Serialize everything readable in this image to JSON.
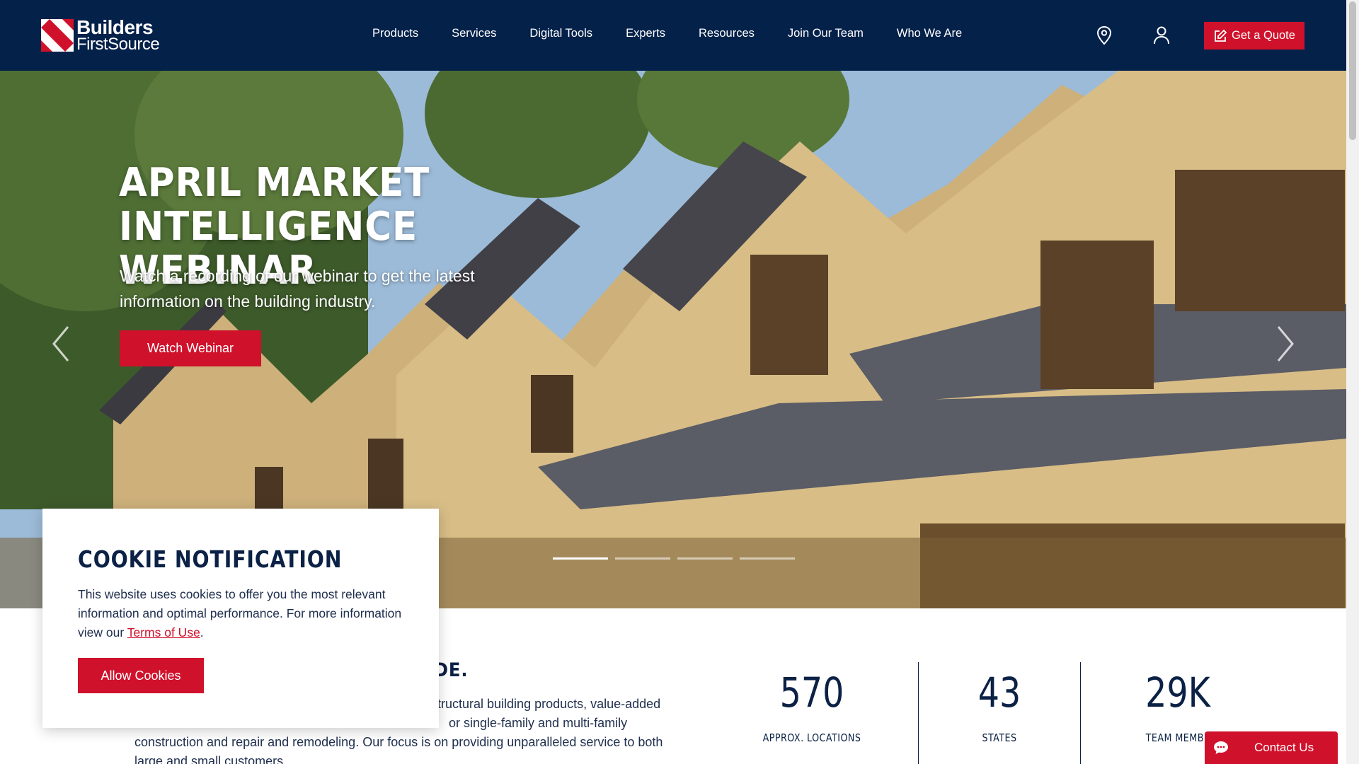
{
  "brand": {
    "logo_line1": "Builders",
    "logo_line2": "FirstSource",
    "trademark": "®",
    "colors": {
      "navy": "#04214a",
      "red": "#d0112b"
    }
  },
  "nav": {
    "items": [
      {
        "label": "Products"
      },
      {
        "label": "Services"
      },
      {
        "label": "Digital Tools"
      },
      {
        "label": "Experts"
      },
      {
        "label": "Resources"
      },
      {
        "label": "Join Our Team"
      },
      {
        "label": "Who We Are"
      }
    ],
    "location_icon": "map-pin-icon",
    "account_icon": "user-icon",
    "quote_label": "Get a Quote",
    "quote_icon": "edit-icon"
  },
  "hero": {
    "title_line1": "April Market",
    "title_line2": "Intelligence Webinar",
    "subtitle": "Watch a recording of our webinar to get the latest information on the building industry.",
    "cta_label": "Watch Webinar",
    "slides": 4,
    "active_slide": 1
  },
  "about": {
    "heading_visible": "WIDE.",
    "body_line1": "tructural building products, value-added",
    "body_line2": "or single-family and multi-family",
    "body_line3": "construction and repair and remodeling. Our focus is on providing unparalleled service to both",
    "body_line4": "large and small customers."
  },
  "stats": [
    {
      "value": "570",
      "label": "APPROX. LOCATIONS"
    },
    {
      "value": "43",
      "label": "STATES"
    },
    {
      "value": "29K",
      "label": "TEAM MEMBE"
    }
  ],
  "cookie": {
    "title": "COOKIE NOTIFICATION",
    "text_before": "This website uses cookies to offer you the most relevant information and optimal performance. For more information view our ",
    "link_label": "Terms of Use",
    "text_after": ".",
    "button_label": "Allow Cookies"
  },
  "contact": {
    "label": "Contact Us",
    "icon": "chat-icon"
  }
}
